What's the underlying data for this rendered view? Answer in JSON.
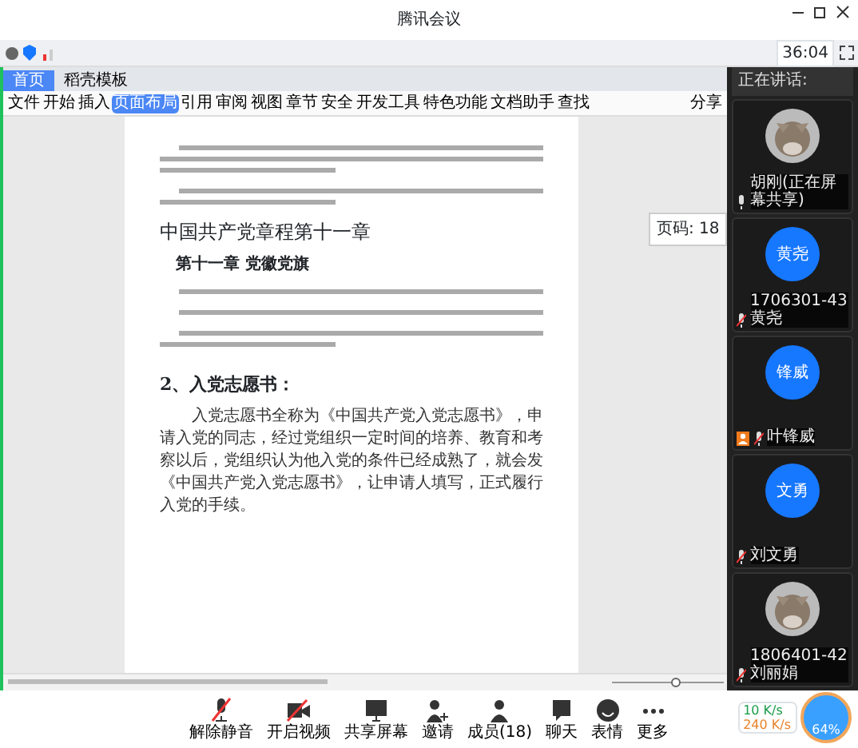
{
  "window": {
    "title": "腾讯会议"
  },
  "top_bar": {
    "timer": "36:04"
  },
  "document_app": {
    "tabs": [
      {
        "label": "首页",
        "selected": true
      },
      {
        "label": "稻壳模板",
        "selected": false
      }
    ],
    "ribbon": [
      {
        "label": "文件",
        "selected": false
      },
      {
        "label": "开始",
        "selected": false
      },
      {
        "label": "插入",
        "selected": false
      },
      {
        "label": "页面布局",
        "selected": true
      },
      {
        "label": "引用",
        "selected": false
      },
      {
        "label": "审阅",
        "selected": false
      },
      {
        "label": "视图",
        "selected": false
      },
      {
        "label": "章节",
        "selected": false
      },
      {
        "label": "安全",
        "selected": false
      },
      {
        "label": "开发工具",
        "selected": false
      },
      {
        "label": "特色功能",
        "selected": false
      },
      {
        "label": "文档助手",
        "selected": false
      },
      {
        "label": "查找",
        "selected": false
      }
    ],
    "ribbon_right": [
      {
        "label": "分享"
      }
    ],
    "page": [
      {
        "kind": "blurred_long"
      },
      {
        "kind": "blurred"
      },
      {
        "kind": "heading",
        "text": "中国共产党章程第十一章"
      },
      {
        "kind": "subheading",
        "text": "第十一章 党徽党旗"
      },
      {
        "kind": "blurred_short"
      },
      {
        "kind": "blurred_short"
      },
      {
        "kind": "blurred"
      },
      {
        "kind": "section",
        "text": "2、入党志愿书："
      },
      {
        "kind": "paragraph",
        "text": "入党志愿书全称为《中国共产党入党志愿书》，申请入党的同志，经过党组织一定时间的培养、教育和考察以后，党组织认为他入党的条件已经成熟了，就会发《中国共产党入党志愿书》，让申请人填写，正式履行入党的手续。"
      }
    ],
    "comment": "页码: 18"
  },
  "speakers": {
    "title": "正在讲话:"
  },
  "participants": [
    {
      "name": "胡刚(正在屏幕共享)",
      "muted": false,
      "host": false
    },
    {
      "kind": "text",
      "avatar": "黄尧",
      "name": "1706301-43黄尧",
      "muted": true,
      "host": false
    },
    {
      "kind": "text",
      "avatar": "锋威",
      "name": "叶锋威",
      "muted": true,
      "host": true
    },
    {
      "kind": "text",
      "avatar": "文勇",
      "name": "刘文勇",
      "muted": true,
      "host": false
    },
    {
      "name": "1806401-42刘丽娟",
      "muted": true,
      "host": false
    }
  ],
  "toolbar": [
    {
      "kind": "mic",
      "label": "解除静音",
      "off": true
    },
    {
      "kind": "video",
      "label": "开启视频",
      "off": true
    },
    {
      "kind": "share",
      "label": "共享屏幕"
    },
    {
      "kind": "invite",
      "label": "邀请"
    },
    {
      "kind": "members",
      "label": "成员(18)"
    },
    {
      "kind": "chat",
      "label": "聊天"
    },
    {
      "kind": "emoji",
      "label": "表情"
    },
    {
      "kind": "more",
      "label": "更多"
    }
  ],
  "network": {
    "upload": "10 K/s",
    "download": "240 K/s",
    "percent": "64%"
  }
}
